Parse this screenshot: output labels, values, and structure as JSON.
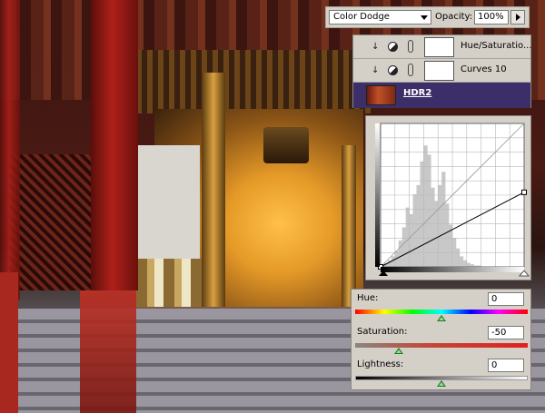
{
  "blend_bar": {
    "mode": "Color Dodge",
    "opacity_label": "Opacity:",
    "opacity_value": "100%"
  },
  "layers": [
    {
      "name": "Hue/Saturatio..."
    },
    {
      "name": "Curves 10"
    },
    {
      "name": "HDR2"
    }
  ],
  "curves": {
    "grid_divisions": 10,
    "input_points": [
      [
        0,
        0
      ],
      [
        1,
        0.52
      ]
    ],
    "histogram": [
      0.02,
      0.03,
      0.05,
      0.08,
      0.12,
      0.2,
      0.3,
      0.45,
      0.4,
      0.55,
      0.62,
      0.8,
      0.92,
      0.85,
      0.6,
      0.5,
      0.62,
      0.72,
      0.48,
      0.32,
      0.22,
      0.14,
      0.08,
      0.05,
      0.03,
      0.02,
      0.01,
      0.01,
      0,
      0,
      0,
      0,
      0,
      0,
      0,
      0,
      0,
      0,
      0,
      0
    ]
  },
  "hue_saturation": {
    "hue_label": "Hue:",
    "hue_value": "0",
    "saturation_label": "Saturation:",
    "saturation_value": "-50",
    "lightness_label": "Lightness:",
    "lightness_value": "0",
    "hue_fraction": 0.5,
    "saturation_fraction": 0.25,
    "lightness_fraction": 0.5
  },
  "colors": {
    "selected_layer_bg": "#3c2e68",
    "panel_bg": "#d4d0c8",
    "slider_thumb": "#1f7a1f"
  },
  "icons": {
    "clip": "clip-arrow-icon",
    "adjustment": "adjustment-layer-icon",
    "link": "chain-link-icon"
  }
}
